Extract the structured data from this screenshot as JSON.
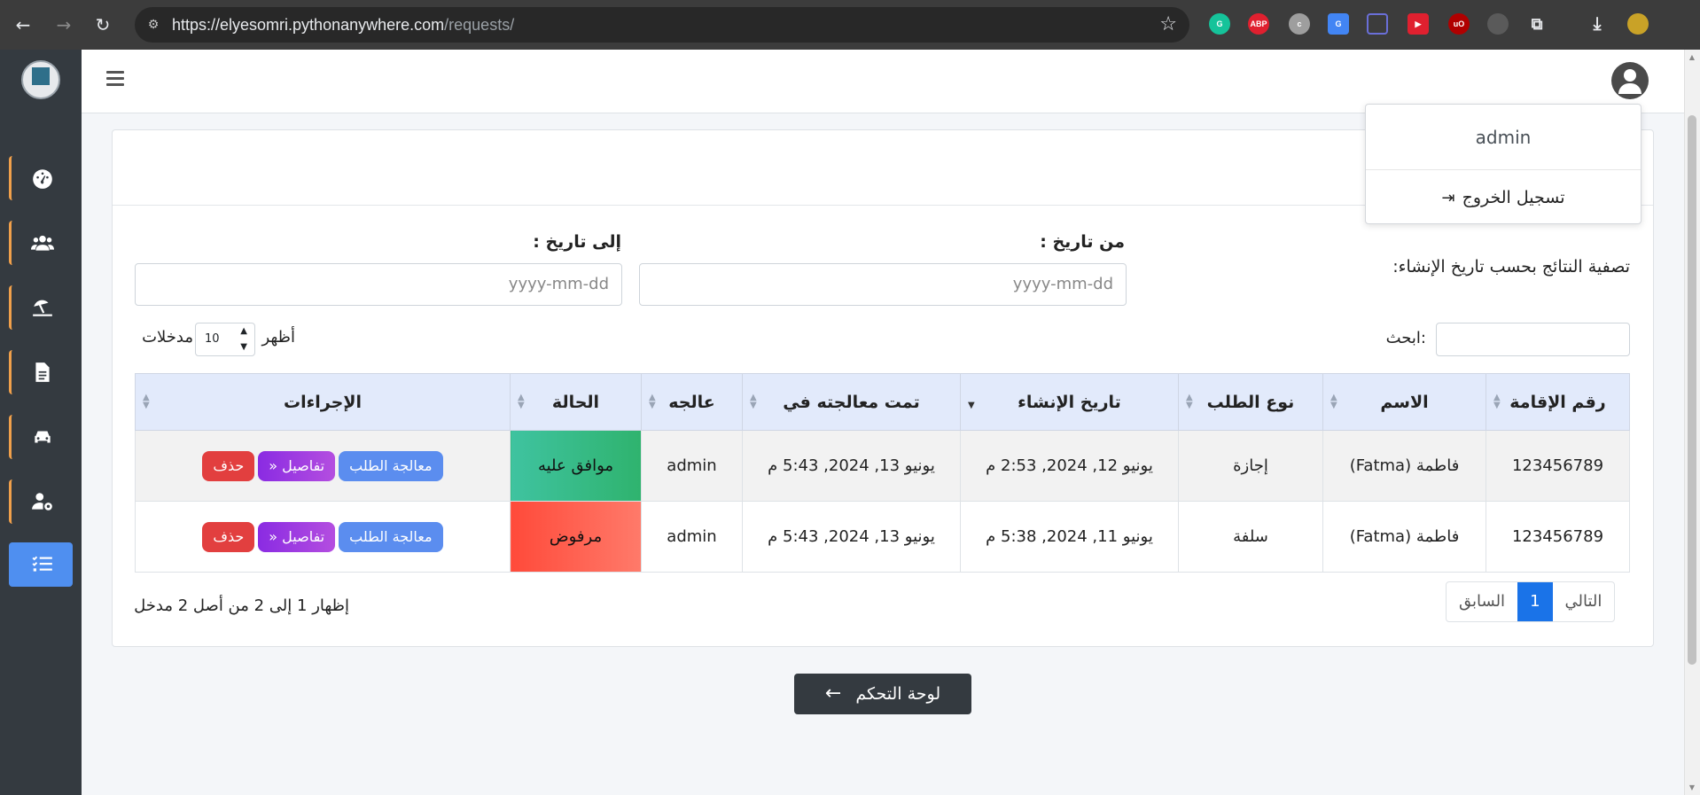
{
  "browser": {
    "url_host": "https://elyesomri.pythonanywhere.com",
    "url_path": "/requests/",
    "extensions": [
      {
        "name": "grammarly-icon",
        "label": "",
        "color": "#15c39a"
      },
      {
        "name": "adblock-icon",
        "label": "ABP",
        "color": "#e0202f"
      },
      {
        "name": "extension-c-icon",
        "label": "",
        "color": "#9e9e9e"
      },
      {
        "name": "translate-icon",
        "label": "",
        "color": "#4285f4"
      },
      {
        "name": "scan-icon",
        "label": "",
        "color": "#6a6fd8"
      },
      {
        "name": "video-ext-icon",
        "label": "",
        "color": "#e0202f"
      },
      {
        "name": "ublock-icon",
        "label": "uO",
        "color": "#b00000"
      },
      {
        "name": "gamepad-icon",
        "label": "",
        "color": "#5a5a5a"
      },
      {
        "name": "puzzle-icon",
        "label": "",
        "color": "#3c3c3c"
      },
      {
        "name": "download-icon",
        "label": "",
        "color": "#3c3c3c"
      },
      {
        "name": "profile-avatar-icon",
        "label": "",
        "color": "#c9a227"
      }
    ]
  },
  "sidebar": {
    "items": [
      {
        "name": "sidebar-item-dashboard",
        "icon": "gauge-icon"
      },
      {
        "name": "sidebar-item-employees",
        "icon": "users-icon"
      },
      {
        "name": "sidebar-item-vacations",
        "icon": "umbrella-beach-icon"
      },
      {
        "name": "sidebar-item-documents",
        "icon": "file-icon"
      },
      {
        "name": "sidebar-item-vehicles",
        "icon": "car-icon"
      },
      {
        "name": "sidebar-item-user-settings",
        "icon": "user-gear-icon"
      },
      {
        "name": "sidebar-item-requests",
        "icon": "list-check-icon",
        "active": true
      }
    ]
  },
  "user_menu": {
    "username": "admin",
    "logout_label": "تسجيل الخروج"
  },
  "filter": {
    "title": "تصفية النتائج بحسب تاريخ الإنشاء:",
    "from_label": "من تاريخ :",
    "to_label": "إلى تاريخ :",
    "from_placeholder": "yyyy-mm-dd",
    "to_placeholder": "yyyy-mm-dd"
  },
  "table_controls": {
    "search_label": ":ابحث",
    "show_label": "أظهر",
    "entries_label": "مدخلات",
    "page_length": "10"
  },
  "table": {
    "headers": [
      "رقم الإقامة",
      "الاسم",
      "نوع الطلب",
      "تاريخ الإنشاء",
      "تمت معالجته في",
      "عالجه",
      "الحالة",
      "الإجراءات"
    ],
    "rows": [
      {
        "residence": "123456789",
        "name": "فاطمة (Fatma)",
        "type": "إجازة",
        "created": "يونيو 12, 2024, 2:53 م",
        "processed": "يونيو 13, 2024, 5:43 م",
        "by": "admin",
        "status": "موافق عليه"
      },
      {
        "residence": "123456789",
        "name": "فاطمة (Fatma)",
        "type": "سلفة",
        "created": "يونيو 11, 2024, 5:38 م",
        "processed": "يونيو 13, 2024, 5:43 م",
        "by": "admin",
        "status": "مرفوض"
      }
    ],
    "actions": {
      "process": "معالجة الطلب",
      "details": "تفاصيل",
      "delete": "حذف"
    }
  },
  "pagination": {
    "info": "إظهار 1 إلى 2 من أصل 2 مدخل",
    "next": "التالي",
    "current": "1",
    "previous": "السابق"
  },
  "dashboard_button": "لوحة التحكم"
}
